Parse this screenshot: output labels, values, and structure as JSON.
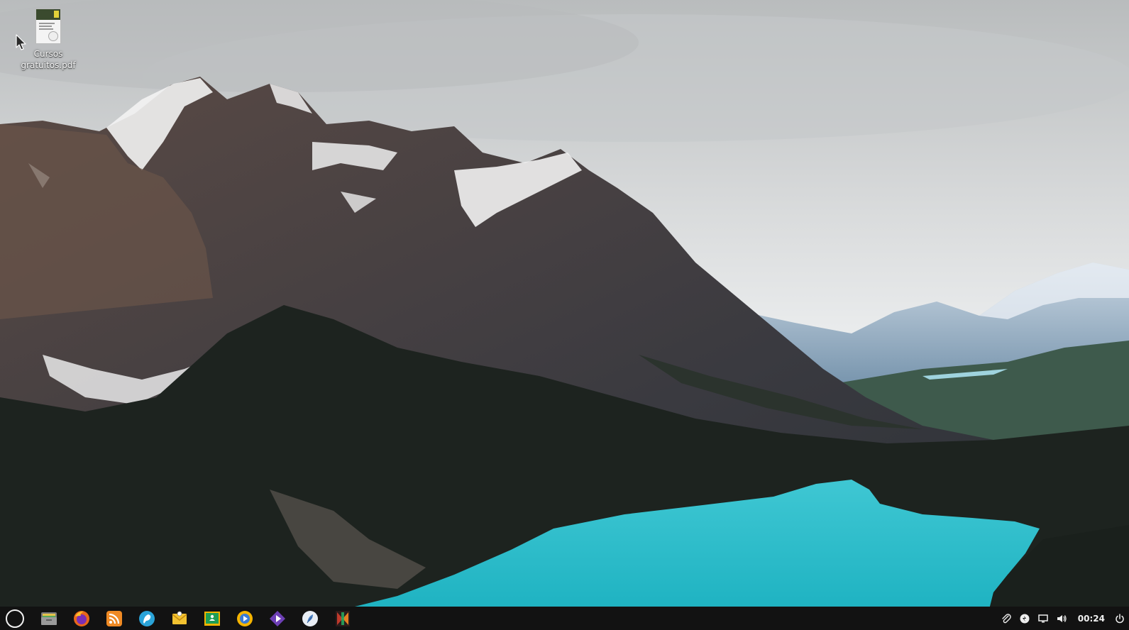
{
  "desktop": {
    "icons": [
      {
        "label": "Cursos gratuitos.pdf",
        "icon": "pdf-file-icon"
      }
    ]
  },
  "taskbar": {
    "launcher_icon": "app-launcher-circle-icon",
    "apps": [
      {
        "name": "file-manager",
        "icon": "folder-icon",
        "color": "#8e8e8e"
      },
      {
        "name": "firefox",
        "icon": "firefox-icon",
        "color": "#e8671b"
      },
      {
        "name": "rss-reader",
        "icon": "rss-icon",
        "color": "#f08a24"
      },
      {
        "name": "chat-client",
        "icon": "chat-bird-icon",
        "color": "#2aa3d8"
      },
      {
        "name": "mail-client",
        "icon": "envelope-icon",
        "color": "#f2c230"
      },
      {
        "name": "classroom",
        "icon": "classroom-icon",
        "color": "#1e9e55"
      },
      {
        "name": "slides-app",
        "icon": "slides-icon",
        "color": "#f5b400"
      },
      {
        "name": "video-player",
        "icon": "play-icon",
        "color": "#6d3fb5"
      },
      {
        "name": "feather-app",
        "icon": "feather-icon",
        "color": "#e9eef5"
      },
      {
        "name": "ide-app",
        "icon": "ide-icon",
        "color": "#c0392b"
      }
    ],
    "tray": [
      {
        "icon": "paperclip-icon"
      },
      {
        "icon": "update-icon"
      },
      {
        "icon": "display-icon"
      },
      {
        "icon": "volume-icon"
      }
    ],
    "clock": "00:24",
    "power_icon": "power-icon"
  }
}
